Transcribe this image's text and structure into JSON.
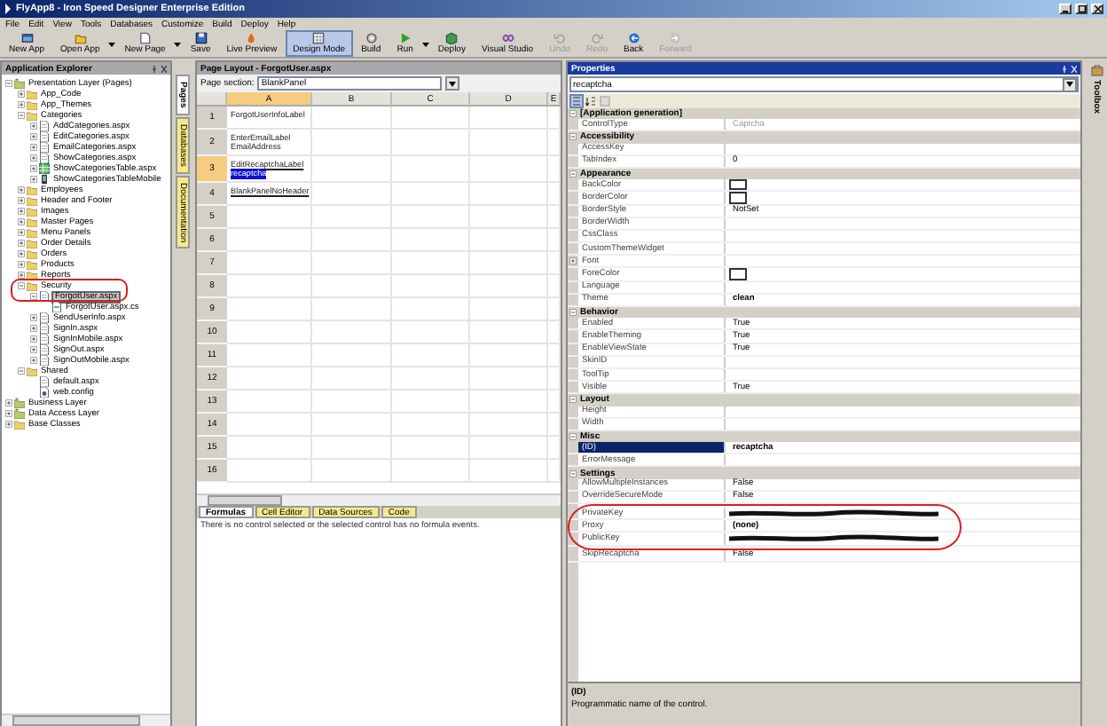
{
  "window": {
    "title": "FlyApp8 - Iron Speed Designer Enterprise Edition"
  },
  "menu": [
    "File",
    "Edit",
    "View",
    "Tools",
    "Databases",
    "Customize",
    "Build",
    "Deploy",
    "Help"
  ],
  "toolbar": [
    {
      "label": "New App",
      "dropdown": false,
      "selected": false,
      "disabled": false
    },
    {
      "label": "Open App",
      "dropdown": true,
      "selected": false,
      "disabled": false
    },
    {
      "label": "New Page",
      "dropdown": true,
      "selected": false,
      "disabled": false
    },
    {
      "label": "Save",
      "dropdown": false,
      "selected": false,
      "disabled": false
    },
    {
      "label": "Live Preview",
      "dropdown": false,
      "selected": false,
      "disabled": false
    },
    {
      "label": "Design Mode",
      "dropdown": false,
      "selected": true,
      "disabled": false
    },
    {
      "label": "Build",
      "dropdown": false,
      "selected": false,
      "disabled": false
    },
    {
      "label": "Run",
      "dropdown": true,
      "selected": false,
      "disabled": false
    },
    {
      "label": "Deploy",
      "dropdown": false,
      "selected": false,
      "disabled": false
    },
    {
      "label": "Visual Studio",
      "dropdown": false,
      "selected": false,
      "disabled": false
    },
    {
      "label": "Undo",
      "dropdown": false,
      "selected": false,
      "disabled": true
    },
    {
      "label": "Redo",
      "dropdown": false,
      "selected": false,
      "disabled": true
    },
    {
      "label": "Back",
      "dropdown": false,
      "selected": false,
      "disabled": false
    },
    {
      "label": "Forward",
      "dropdown": false,
      "selected": false,
      "disabled": true
    }
  ],
  "explorer": {
    "title": "Application Explorer",
    "tree": [
      {
        "label": "Presentation Layer (Pages)",
        "kind": "layer",
        "expanded": true,
        "selected": false,
        "children": [
          {
            "label": "App_Code",
            "kind": "folder",
            "expanded": false,
            "selected": false
          },
          {
            "label": "App_Themes",
            "kind": "folder",
            "expanded": false,
            "selected": false
          },
          {
            "label": "Categories",
            "kind": "folder",
            "expanded": true,
            "selected": false,
            "children": [
              {
                "label": "AddCategories.aspx",
                "kind": "page",
                "expanded": false,
                "selected": false
              },
              {
                "label": "EditCategories.aspx",
                "kind": "page",
                "expanded": false,
                "selected": false
              },
              {
                "label": "EmailCategories.aspx",
                "kind": "page",
                "expanded": false,
                "selected": false
              },
              {
                "label": "ShowCategories.aspx",
                "kind": "page",
                "expanded": false,
                "selected": false
              },
              {
                "label": "ShowCategoriesTable.aspx",
                "kind": "table",
                "expanded": false,
                "selected": false
              },
              {
                "label": "ShowCategoriesTableMobile",
                "kind": "mobile",
                "expanded": false,
                "selected": false
              }
            ]
          },
          {
            "label": "Employees",
            "kind": "folder",
            "expanded": false,
            "selected": false
          },
          {
            "label": "Header and Footer",
            "kind": "folder",
            "expanded": false,
            "selected": false
          },
          {
            "label": "Images",
            "kind": "folder",
            "expanded": false,
            "selected": false
          },
          {
            "label": "Master Pages",
            "kind": "folder",
            "expanded": false,
            "selected": false
          },
          {
            "label": "Menu Panels",
            "kind": "folder",
            "expanded": false,
            "selected": false
          },
          {
            "label": "Order Details",
            "kind": "folder",
            "expanded": false,
            "selected": false
          },
          {
            "label": "Orders",
            "kind": "folder",
            "expanded": false,
            "selected": false
          },
          {
            "label": "Products",
            "kind": "folder",
            "expanded": false,
            "selected": false
          },
          {
            "label": "Reports",
            "kind": "folder",
            "expanded": false,
            "selected": false
          },
          {
            "label": "Security",
            "kind": "folder",
            "expanded": true,
            "selected": false,
            "children": [
              {
                "label": "ForgotUser.aspx",
                "kind": "page",
                "expanded": true,
                "selected": true,
                "children": [
                  {
                    "label": "ForgotUser.aspx.cs",
                    "kind": "code",
                    "selected": false
                  }
                ]
              },
              {
                "label": "SendUserInfo.aspx",
                "kind": "page",
                "expanded": false,
                "selected": false
              },
              {
                "label": "SignIn.aspx",
                "kind": "page",
                "expanded": false,
                "selected": false
              },
              {
                "label": "SignInMobile.aspx",
                "kind": "page",
                "expanded": false,
                "selected": false
              },
              {
                "label": "SignOut.aspx",
                "kind": "page",
                "expanded": false,
                "selected": false
              },
              {
                "label": "SignOutMobile.aspx",
                "kind": "page",
                "expanded": false,
                "selected": false
              }
            ]
          },
          {
            "label": "Shared",
            "kind": "folder",
            "expanded": true,
            "selected": false,
            "children": [
              {
                "label": "default.aspx",
                "kind": "page",
                "selected": false
              },
              {
                "label": "web.config",
                "kind": "config",
                "selected": false
              }
            ]
          }
        ]
      },
      {
        "label": "Business Layer",
        "kind": "layer",
        "expanded": false,
        "selected": false
      },
      {
        "label": "Data Access Layer",
        "kind": "layer",
        "expanded": false,
        "selected": false
      },
      {
        "label": "Base Classes",
        "kind": "folder",
        "expanded": false,
        "selected": false
      }
    ]
  },
  "side_tabs": [
    {
      "label": "Pages",
      "selected": true
    },
    {
      "label": "Databases",
      "selected": false
    },
    {
      "label": "Documentation",
      "selected": false
    }
  ],
  "page_layout": {
    "title": "Page Layout - ForgotUser.aspx",
    "section_label": "Page section:",
    "section_value": "BlankPanel",
    "columns": [
      {
        "label": "A",
        "selected": true
      },
      {
        "label": "B",
        "selected": false
      },
      {
        "label": "C",
        "selected": false
      },
      {
        "label": "D",
        "selected": false
      },
      {
        "label": "E",
        "selected": false
      }
    ],
    "rows": [
      {
        "label": "1",
        "selected": false,
        "items": [
          {
            "text": "ForgotUserInfoLabel",
            "kind": "label"
          }
        ]
      },
      {
        "label": "2",
        "selected": false,
        "items": [
          {
            "text": "EnterEmailLabel",
            "kind": "label"
          },
          {
            "text": "EmailAddress",
            "kind": "label"
          }
        ]
      },
      {
        "label": "3",
        "selected": true,
        "items": [
          {
            "text": "EditRecaptchaLabel",
            "kind": "link"
          },
          {
            "text": "recaptcha",
            "kind": "highlight"
          }
        ]
      },
      {
        "label": "4",
        "selected": false,
        "items": [
          {
            "text": "BlankPanelNoHeader",
            "kind": "link"
          }
        ]
      },
      {
        "label": "5",
        "selected": false,
        "items": []
      },
      {
        "label": "6",
        "selected": false,
        "items": []
      },
      {
        "label": "7",
        "selected": false,
        "items": []
      },
      {
        "label": "8",
        "selected": false,
        "items": []
      },
      {
        "label": "9",
        "selected": false,
        "items": []
      },
      {
        "label": "10",
        "selected": false,
        "items": []
      },
      {
        "label": "11",
        "selected": false,
        "items": []
      },
      {
        "label": "12",
        "selected": false,
        "items": []
      },
      {
        "label": "13",
        "selected": false,
        "items": []
      },
      {
        "label": "14",
        "selected": false,
        "items": []
      },
      {
        "label": "15",
        "selected": false,
        "items": []
      },
      {
        "label": "16",
        "selected": false,
        "items": []
      }
    ]
  },
  "bottom_tabs": [
    {
      "label": "Formulas",
      "selected": true
    },
    {
      "label": "Cell Editor",
      "selected": false
    },
    {
      "label": "Data Sources",
      "selected": false
    },
    {
      "label": "Code",
      "selected": false
    }
  ],
  "formula_message": "There is no control selected or the selected control has no formula events.",
  "properties": {
    "title": "Properties",
    "object": "recaptcha",
    "groups": [
      {
        "name": "[Application generation]",
        "expanded": true,
        "rows": [
          {
            "name": "ControlType",
            "value": "Captcha",
            "kind": "text",
            "disabled": true
          }
        ]
      },
      {
        "name": "Accessibility",
        "expanded": true,
        "rows": [
          {
            "name": "AccessKey",
            "kind": "text"
          },
          {
            "name": "TabIndex",
            "value": "0",
            "kind": "text"
          }
        ]
      },
      {
        "name": "Appearance",
        "expanded": true,
        "rows": [
          {
            "name": "BackColor",
            "kind": "color"
          },
          {
            "name": "BorderColor",
            "kind": "color"
          },
          {
            "name": "BorderStyle",
            "value": "NotSet",
            "kind": "text"
          },
          {
            "name": "BorderWidth",
            "kind": "text"
          },
          {
            "name": "CssClass",
            "kind": "text"
          },
          {
            "name": "CustomThemeWidget",
            "kind": "text"
          },
          {
            "name": "Font",
            "kind": "text",
            "expanded": false
          },
          {
            "name": "ForeColor",
            "kind": "color"
          },
          {
            "name": "Language",
            "kind": "text"
          },
          {
            "name": "Theme",
            "value": "clean",
            "kind": "text",
            "modified": true
          }
        ]
      },
      {
        "name": "Behavior",
        "expanded": true,
        "rows": [
          {
            "name": "Enabled",
            "value": "True",
            "kind": "text"
          },
          {
            "name": "EnableTheming",
            "value": "True",
            "kind": "text"
          },
          {
            "name": "EnableViewState",
            "value": "True",
            "kind": "text"
          },
          {
            "name": "SkinID",
            "kind": "text"
          },
          {
            "name": "ToolTip",
            "kind": "text"
          },
          {
            "name": "Visible",
            "value": "True",
            "kind": "text"
          }
        ]
      },
      {
        "name": "Layout",
        "expanded": true,
        "rows": [
          {
            "name": "Height",
            "kind": "text"
          },
          {
            "name": "Width",
            "kind": "text"
          }
        ]
      },
      {
        "name": "Misc",
        "expanded": true,
        "rows": [
          {
            "name": "(ID)",
            "value": "recaptcha",
            "kind": "text",
            "modified": true,
            "selected": true
          },
          {
            "name": "ErrorMessage",
            "kind": "text"
          }
        ]
      },
      {
        "name": "Settings",
        "expanded": true,
        "rows": [
          {
            "name": "AllowMultipleInstances",
            "value": "False",
            "kind": "text"
          },
          {
            "name": "OverrideSecureMode",
            "value": "False",
            "kind": "text"
          },
          {
            "name": "PrivateKey",
            "kind": "redacted",
            "modified": true
          },
          {
            "name": "Proxy",
            "value": "(none)",
            "kind": "text",
            "modified": true
          },
          {
            "name": "PublicKey",
            "kind": "redacted",
            "modified": true
          },
          {
            "name": "SkipRecaptcha",
            "value": "False",
            "kind": "text"
          }
        ]
      }
    ],
    "description_title": "(ID)",
    "description": "Programmatic name of the control."
  },
  "toolbox": {
    "label": "Toolbox"
  }
}
